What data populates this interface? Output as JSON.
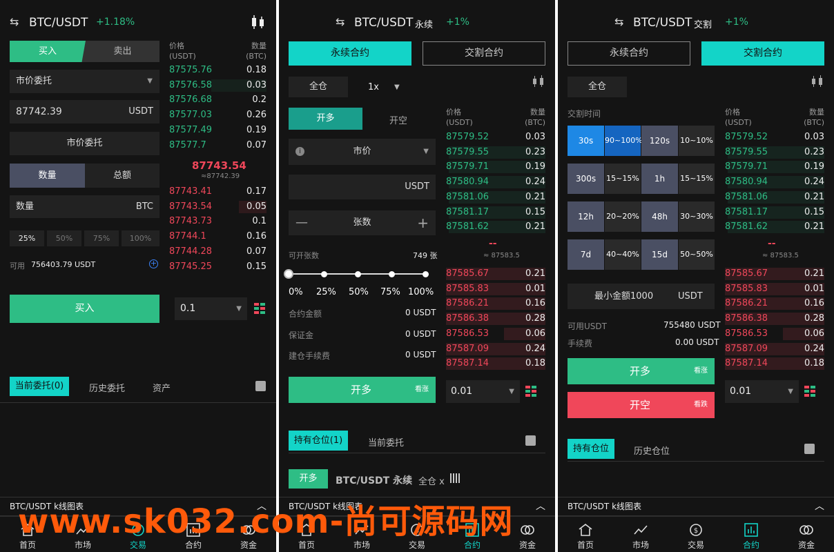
{
  "watermark": "www.sk032.com-尚可源码网",
  "spot": {
    "pair": "BTC/USDT",
    "change": "+1.18%",
    "buy_tab": "买入",
    "sell_tab": "卖出",
    "order_type": "市价委托",
    "price": "87742.39",
    "price_unit": "USDT",
    "market_btn": "市价委托",
    "qty_tab": "数量",
    "total_tab": "总额",
    "qty_placeholder": "数量",
    "qty_unit": "BTC",
    "pcts": [
      "25%",
      "50%",
      "75%",
      "100%"
    ],
    "avail_label": "可用",
    "avail_value": "756403.79 USDT",
    "buy_btn": "买入",
    "depth": "0.1",
    "ob_price_h": "价格",
    "ob_price_u": "(USDT)",
    "ob_qty_h": "数量",
    "ob_qty_u": "(BTC)",
    "asks_top": [
      {
        "p": "87575.76",
        "q": "0.18"
      },
      {
        "p": "87576.58",
        "q": "0.03"
      },
      {
        "p": "87576.68",
        "q": "0.2"
      },
      {
        "p": "87577.03",
        "q": "0.26"
      },
      {
        "p": "87577.49",
        "q": "0.19"
      },
      {
        "p": "87577.7",
        "q": "0.07"
      }
    ],
    "last": "87743.54",
    "last_sub": "≈87742.39",
    "bids": [
      {
        "p": "87743.41",
        "q": "0.17"
      },
      {
        "p": "87743.54",
        "q": "0.05"
      },
      {
        "p": "87743.73",
        "q": "0.1"
      },
      {
        "p": "87744.1",
        "q": "0.16"
      },
      {
        "p": "87744.28",
        "q": "0.07"
      },
      {
        "p": "87745.25",
        "q": "0.15"
      }
    ],
    "tabs": [
      "当前委托(0)",
      "历史委托",
      "资产"
    ]
  },
  "perp": {
    "pair": "BTC/USDT",
    "pair_tag": "永续",
    "change": "+1%",
    "tab_perp": "永续合约",
    "tab_delivery": "交割合约",
    "margin": "全仓",
    "leverage": "1x",
    "open_long": "开多",
    "open_short": "开空",
    "order_type": "市价",
    "usdt": "USDT",
    "qty": "张数",
    "avail_label": "可开张数",
    "avail_value": "749 张",
    "slider": [
      "0%",
      "25%",
      "50%",
      "75%",
      "100%"
    ],
    "rows": [
      {
        "k": "合约金额",
        "v": "0 USDT"
      },
      {
        "k": "保证金",
        "v": "0 USDT"
      },
      {
        "k": "建仓手续费",
        "v": "0 USDT"
      }
    ],
    "main_btn": "开多",
    "main_btn_tag": "看涨",
    "depth": "0.01",
    "ob_price_h": "价格",
    "ob_price_u": "(USDT)",
    "ob_qty_h": "数量",
    "ob_qty_u": "(BTC)",
    "green_rows": [
      {
        "p": "87579.52",
        "q": "0.03"
      },
      {
        "p": "87579.55",
        "q": "0.23"
      },
      {
        "p": "87579.71",
        "q": "0.19"
      },
      {
        "p": "87580.94",
        "q": "0.24"
      },
      {
        "p": "87581.06",
        "q": "0.21"
      },
      {
        "p": "87581.17",
        "q": "0.15"
      },
      {
        "p": "87581.62",
        "q": "0.21"
      }
    ],
    "mid": "--",
    "mid_sub": "≈ 87583.5",
    "red_rows": [
      {
        "p": "87585.67",
        "q": "0.21"
      },
      {
        "p": "87585.83",
        "q": "0.01"
      },
      {
        "p": "87586.21",
        "q": "0.16"
      },
      {
        "p": "87586.38",
        "q": "0.28"
      },
      {
        "p": "87586.53",
        "q": "0.06"
      },
      {
        "p": "87587.09",
        "q": "0.24"
      },
      {
        "p": "87587.14",
        "q": "0.18"
      }
    ],
    "tabs": [
      "持有仓位(1)",
      "当前委托"
    ],
    "position_badge": "开多",
    "position_pair": "BTC/USDT 永续",
    "position_mode": "全仓 x"
  },
  "delivery": {
    "pair": "BTC/USDT",
    "pair_tag": "交割",
    "change": "+1%",
    "tab_perp": "永续合约",
    "tab_delivery": "交割合约",
    "margin": "全仓",
    "time_label": "交割时间",
    "times": [
      {
        "t": "30s",
        "r": "90~100%"
      },
      {
        "t": "120s",
        "r": "10~10%"
      },
      {
        "t": "300s",
        "r": "15~15%"
      },
      {
        "t": "1h",
        "r": "15~15%"
      },
      {
        "t": "12h",
        "r": "20~20%"
      },
      {
        "t": "48h",
        "r": "30~30%"
      },
      {
        "t": "7d",
        "r": "40~40%"
      },
      {
        "t": "15d",
        "r": "50~50%"
      }
    ],
    "min_amount": "最小金额1000",
    "unit": "USDT",
    "avail_label": "可用USDT",
    "avail_value": "755480 USDT",
    "fee_label": "手续费",
    "fee_value": "0.00 USDT",
    "long_btn": "开多",
    "long_tag": "看涨",
    "short_btn": "开空",
    "short_tag": "看跌",
    "depth": "0.01",
    "tabs": [
      "持有仓位",
      "历史仓位"
    ]
  },
  "kbar": "BTC/USDT k线图表",
  "nav": [
    "首页",
    "市场",
    "交易",
    "合约",
    "资金"
  ]
}
